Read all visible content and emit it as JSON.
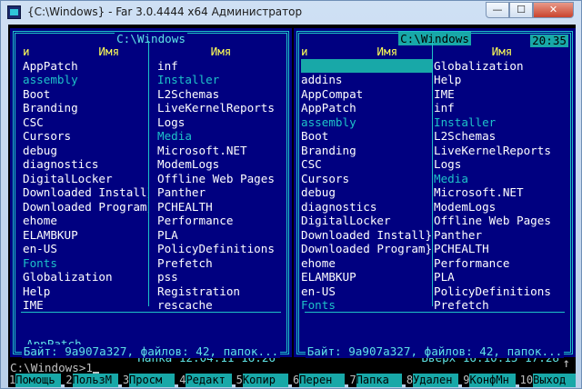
{
  "window": {
    "title": "{C:\\Windows} - Far 3.0.4444 x64 Администратор",
    "min_glyph": "—",
    "max_glyph": "☐",
    "close_glyph": "✕"
  },
  "clock": "20:35",
  "left_panel": {
    "path": "C:\\Windows",
    "col_headers": [
      "и",
      "Имя",
      "Имя"
    ],
    "col1": [
      {
        "text": "AppPatch",
        "dim": false
      },
      {
        "text": "assembly",
        "dim": true
      },
      {
        "text": "Boot",
        "dim": false
      },
      {
        "text": "Branding",
        "dim": false
      },
      {
        "text": "CSC",
        "dim": false
      },
      {
        "text": "Cursors",
        "dim": false
      },
      {
        "text": "debug",
        "dim": false
      },
      {
        "text": "diagnostics",
        "dim": false
      },
      {
        "text": "DigitalLocker",
        "dim": false
      },
      {
        "text": "Downloaded Install}",
        "dim": false
      },
      {
        "text": "Downloaded Program}",
        "dim": false
      },
      {
        "text": "ehome",
        "dim": false
      },
      {
        "text": "ELAMBKUP",
        "dim": false
      },
      {
        "text": "en-US",
        "dim": false
      },
      {
        "text": "Fonts",
        "dim": true
      },
      {
        "text": "Globalization",
        "dim": false
      },
      {
        "text": "Help",
        "dim": false
      },
      {
        "text": "IME",
        "dim": false
      }
    ],
    "col2": [
      {
        "text": "inf",
        "dim": false
      },
      {
        "text": "Installer",
        "dim": true
      },
      {
        "text": "L2Schemas",
        "dim": false
      },
      {
        "text": "LiveKernelReports",
        "dim": false
      },
      {
        "text": "Logs",
        "dim": false
      },
      {
        "text": "Media",
        "dim": true
      },
      {
        "text": "Microsoft.NET",
        "dim": false
      },
      {
        "text": "ModemLogs",
        "dim": false
      },
      {
        "text": "Offline Web Pages",
        "dim": false
      },
      {
        "text": "Panther",
        "dim": false
      },
      {
        "text": "PCHEALTH",
        "dim": false
      },
      {
        "text": "Performance",
        "dim": false
      },
      {
        "text": "PLA",
        "dim": false
      },
      {
        "text": "PolicyDefinitions",
        "dim": false
      },
      {
        "text": "Prefetch",
        "dim": false
      },
      {
        "text": "pss",
        "dim": false
      },
      {
        "text": "Registration",
        "dim": false
      },
      {
        "text": "rescache",
        "dim": false
      }
    ],
    "status_name": "AppPatch",
    "status_info": "Папка 12.04.11 16:26",
    "summary": "Байт: 9a907a327, файлов: 42, папок..."
  },
  "right_panel": {
    "path": "C:\\Windows",
    "col_headers": [
      "и",
      "Имя",
      "Имя"
    ],
    "col1": [
      {
        "text": "",
        "dim": false,
        "cursor": true
      },
      {
        "text": "addins",
        "dim": false
      },
      {
        "text": "AppCompat",
        "dim": false
      },
      {
        "text": "AppPatch",
        "dim": false
      },
      {
        "text": "assembly",
        "dim": true
      },
      {
        "text": "Boot",
        "dim": false
      },
      {
        "text": "Branding",
        "dim": false
      },
      {
        "text": "CSC",
        "dim": false
      },
      {
        "text": "Cursors",
        "dim": false
      },
      {
        "text": "debug",
        "dim": false
      },
      {
        "text": "diagnostics",
        "dim": false
      },
      {
        "text": "DigitalLocker",
        "dim": false
      },
      {
        "text": "Downloaded Install}",
        "dim": false
      },
      {
        "text": "Downloaded Program}",
        "dim": false
      },
      {
        "text": "ehome",
        "dim": false
      },
      {
        "text": "ELAMBKUP",
        "dim": false
      },
      {
        "text": "en-US",
        "dim": false
      },
      {
        "text": "Fonts",
        "dim": true
      }
    ],
    "col2": [
      {
        "text": "Globalization",
        "dim": false
      },
      {
        "text": "Help",
        "dim": false
      },
      {
        "text": "IME",
        "dim": false
      },
      {
        "text": "inf",
        "dim": false
      },
      {
        "text": "Installer",
        "dim": true
      },
      {
        "text": "L2Schemas",
        "dim": false
      },
      {
        "text": "LiveKernelReports",
        "dim": false
      },
      {
        "text": "Logs",
        "dim": false
      },
      {
        "text": "Media",
        "dim": true
      },
      {
        "text": "Microsoft.NET",
        "dim": false
      },
      {
        "text": "ModemLogs",
        "dim": false
      },
      {
        "text": "Offline Web Pages",
        "dim": false
      },
      {
        "text": "Panther",
        "dim": false
      },
      {
        "text": "PCHEALTH",
        "dim": false
      },
      {
        "text": "Performance",
        "dim": false
      },
      {
        "text": "PLA",
        "dim": false
      },
      {
        "text": "PolicyDefinitions",
        "dim": false
      },
      {
        "text": "Prefetch",
        "dim": false
      }
    ],
    "status_name": "..",
    "status_info": "Вверх 16.10.15 17:28",
    "summary": "Байт: 9a907a327, файлов: 42, папок..."
  },
  "command_line": {
    "prompt": "C:\\Windows>",
    "value": "1",
    "scroll_glyph": "↑"
  },
  "keybar": [
    {
      "num": "1",
      "label": "Помощь"
    },
    {
      "num": "2",
      "label": "ПользМ"
    },
    {
      "num": "3",
      "label": "Просм"
    },
    {
      "num": "4",
      "label": "Редакт"
    },
    {
      "num": "5",
      "label": "Копир"
    },
    {
      "num": "6",
      "label": "Перен"
    },
    {
      "num": "7",
      "label": "Папка"
    },
    {
      "num": "8",
      "label": "Удален"
    },
    {
      "num": "9",
      "label": "КонфМн"
    },
    {
      "num": "10",
      "label": "Выход"
    }
  ],
  "colors": {
    "panel_bg": "#000080",
    "frame": "#1ec2c8",
    "header": "#ffff54",
    "file": "#ffffff",
    "dim_dir": "#1ec2c8",
    "cursor_bg": "#18a8a8"
  }
}
